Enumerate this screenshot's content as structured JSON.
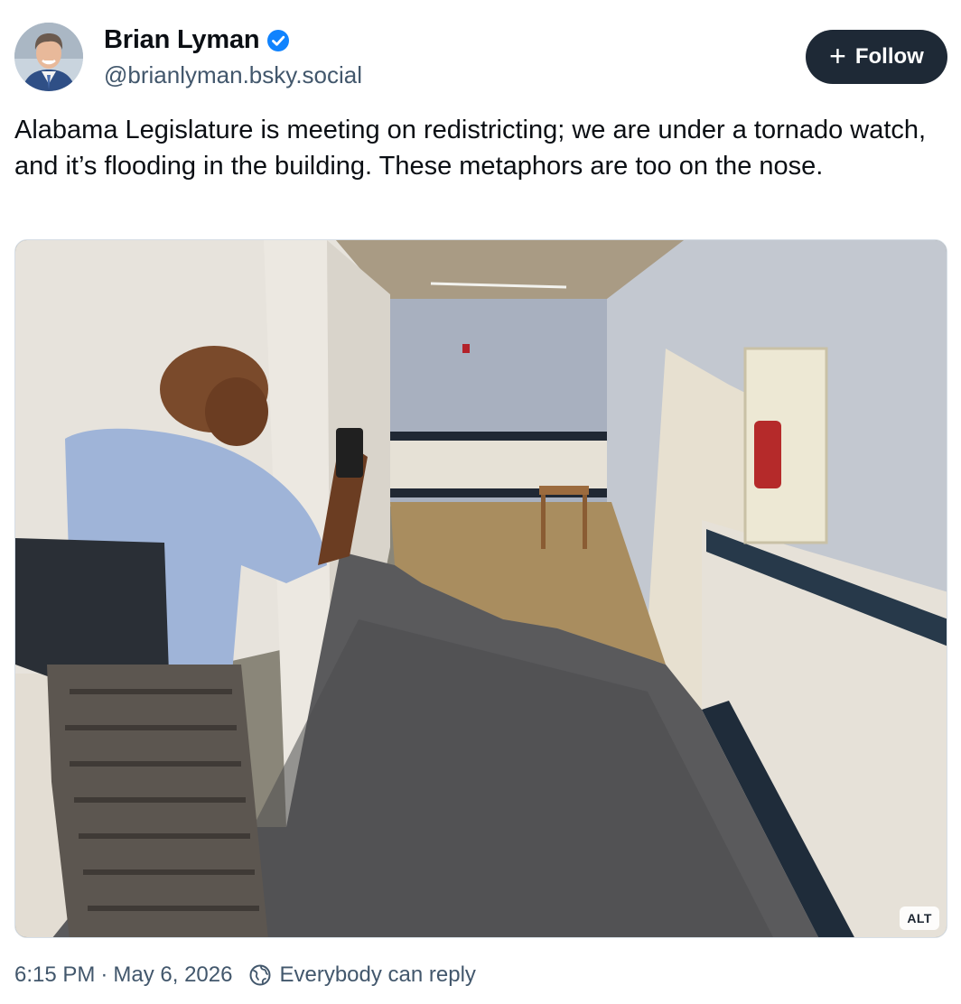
{
  "author": {
    "display_name": "Brian Lyman",
    "handle": "@brianlyman.bsky.social",
    "verified": true,
    "avatar_icon": "profile-photo"
  },
  "follow_button": {
    "icon": "plus-icon",
    "label": "Follow"
  },
  "post": {
    "text": "Alabama Legislature is meeting on redistricting; we are under a tornado watch, and it’s flooding in the building. These metaphors are too on the nose."
  },
  "media": {
    "alt_badge": "ALT"
  },
  "footer": {
    "time": "6:15 PM",
    "separator": "·",
    "date": "May 6, 2026",
    "reply_icon": "globe-icon",
    "reply_setting": "Everybody can reply"
  },
  "colors": {
    "verified_blue": "#1083fe",
    "follow_bg": "#1e2936",
    "muted_text": "#42576c"
  }
}
